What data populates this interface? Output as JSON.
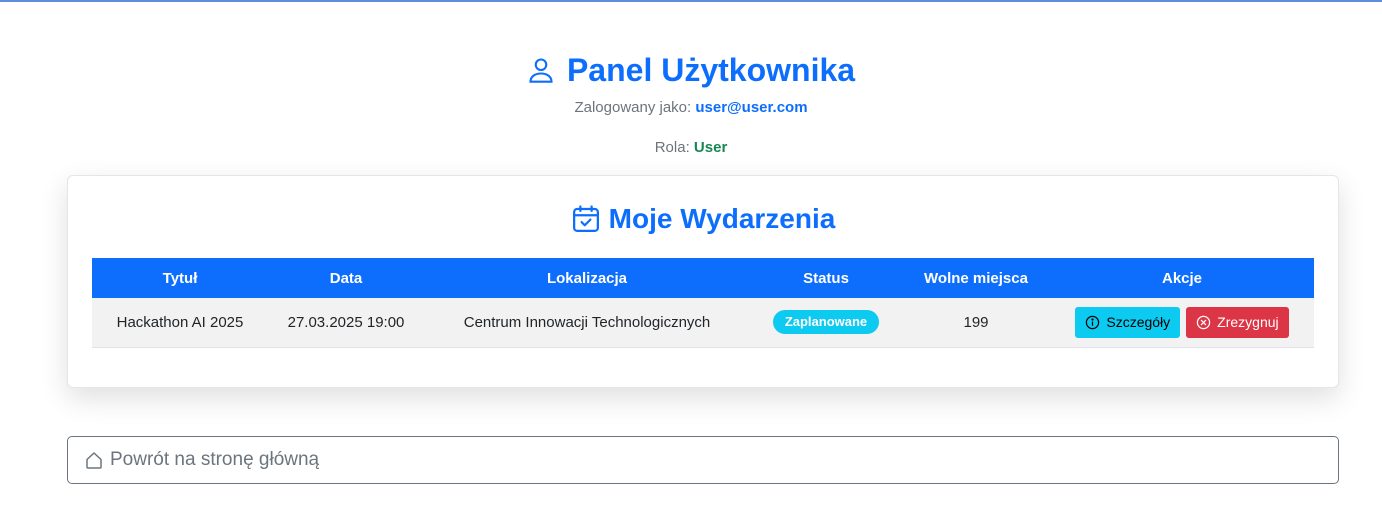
{
  "header": {
    "title": "Panel Użytkownika",
    "title_icon": "person-icon",
    "logged_label": "Zalogowany jako:",
    "email": "user@user.com",
    "role_label": "Rola:",
    "role": "User"
  },
  "events_card": {
    "title": "Moje Wydarzenia",
    "title_icon": "calendar-check-icon",
    "columns": [
      "Tytuł",
      "Data",
      "Lokalizacja",
      "Status",
      "Wolne miejsca",
      "Akcje"
    ],
    "rows": [
      {
        "title": "Hackathon AI 2025",
        "date": "27.03.2025 19:00",
        "location": "Centrum Innowacji Technologicznych",
        "status": "Zaplanowane",
        "free_seats": "199",
        "details_label": "Szczegóły",
        "resign_label": "Zrezygnuj"
      }
    ]
  },
  "home_button": {
    "label": "Powrót na stronę główną",
    "icon": "house-icon"
  },
  "colors": {
    "primary": "#0d6efd",
    "info": "#0dcaf0",
    "danger": "#dc3545",
    "success": "#198754"
  }
}
